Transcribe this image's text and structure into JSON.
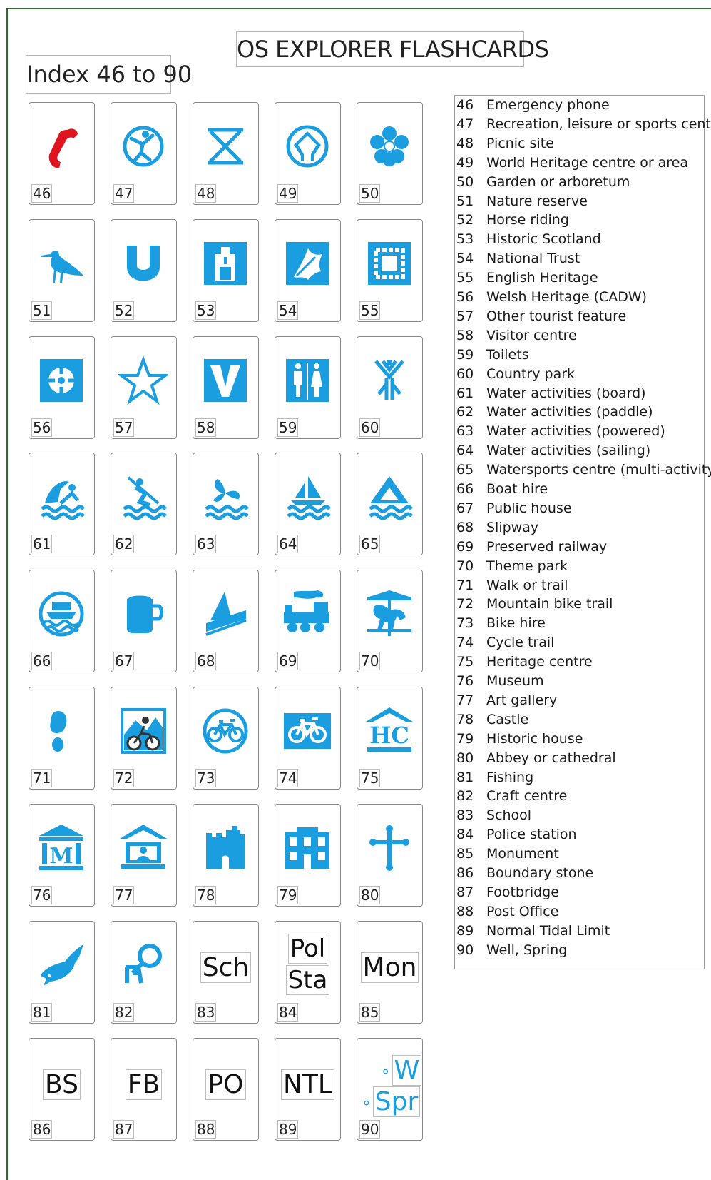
{
  "header": {
    "title": "OS EXPLORER FLASHCARDS",
    "subtitle": "Index 46 to 90"
  },
  "colors": {
    "icon": "#1a9ee0",
    "phone": "#e0141e",
    "frame": "#2f6f2f"
  },
  "cards": [
    {
      "num": "46",
      "icon": "phone-icon"
    },
    {
      "num": "47",
      "icon": "recreation-centre-icon"
    },
    {
      "num": "48",
      "icon": "picnic-site-icon"
    },
    {
      "num": "49",
      "icon": "world-heritage-icon"
    },
    {
      "num": "50",
      "icon": "garden-flower-icon"
    },
    {
      "num": "51",
      "icon": "nature-reserve-bird-icon"
    },
    {
      "num": "52",
      "icon": "horseshoe-icon"
    },
    {
      "num": "53",
      "icon": "historic-scotland-icon"
    },
    {
      "num": "54",
      "icon": "national-trust-icon"
    },
    {
      "num": "55",
      "icon": "english-heritage-icon"
    },
    {
      "num": "56",
      "icon": "cadw-icon"
    },
    {
      "num": "57",
      "icon": "star-icon"
    },
    {
      "num": "58",
      "icon": "visitor-centre-icon"
    },
    {
      "num": "59",
      "icon": "toilets-icon"
    },
    {
      "num": "60",
      "icon": "country-park-icon"
    },
    {
      "num": "61",
      "icon": "water-board-icon"
    },
    {
      "num": "62",
      "icon": "water-paddle-icon"
    },
    {
      "num": "63",
      "icon": "water-powered-icon"
    },
    {
      "num": "64",
      "icon": "water-sailing-icon"
    },
    {
      "num": "65",
      "icon": "watersports-centre-icon"
    },
    {
      "num": "66",
      "icon": "boat-hire-icon"
    },
    {
      "num": "67",
      "icon": "public-house-mug-icon"
    },
    {
      "num": "68",
      "icon": "slipway-icon"
    },
    {
      "num": "69",
      "icon": "steam-train-icon"
    },
    {
      "num": "70",
      "icon": "carousel-icon"
    },
    {
      "num": "71",
      "icon": "footprint-icon"
    },
    {
      "num": "72",
      "icon": "mountain-bike-icon"
    },
    {
      "num": "73",
      "icon": "bike-hire-icon"
    },
    {
      "num": "74",
      "icon": "cycle-trail-icon"
    },
    {
      "num": "75",
      "icon": "heritage-centre-icon",
      "label": "HC"
    },
    {
      "num": "76",
      "icon": "museum-icon",
      "label": "M"
    },
    {
      "num": "77",
      "icon": "art-gallery-icon"
    },
    {
      "num": "78",
      "icon": "castle-icon"
    },
    {
      "num": "79",
      "icon": "historic-house-icon"
    },
    {
      "num": "80",
      "icon": "cross-icon"
    },
    {
      "num": "81",
      "icon": "fish-icon"
    },
    {
      "num": "82",
      "icon": "craft-centre-icon"
    },
    {
      "num": "83",
      "text": [
        "Sch"
      ]
    },
    {
      "num": "84",
      "text": [
        "Pol",
        "Sta"
      ]
    },
    {
      "num": "85",
      "text": [
        "Mon"
      ]
    },
    {
      "num": "86",
      "text": [
        "BS"
      ]
    },
    {
      "num": "87",
      "text": [
        "FB"
      ]
    },
    {
      "num": "88",
      "text": [
        "PO"
      ]
    },
    {
      "num": "89",
      "text": [
        "NTL"
      ]
    },
    {
      "num": "90",
      "text": [
        "W",
        "Spr"
      ]
    }
  ],
  "legend": [
    {
      "n": "46",
      "label": "Emergency phone"
    },
    {
      "n": "47",
      "label": "Recreation, leisure or sports centre"
    },
    {
      "n": "48",
      "label": "Picnic site"
    },
    {
      "n": "49",
      "label": "World Heritage centre or area"
    },
    {
      "n": "50",
      "label": "Garden or arboretum"
    },
    {
      "n": "51",
      "label": "Nature reserve"
    },
    {
      "n": "52",
      "label": "Horse riding"
    },
    {
      "n": "53",
      "label": "Historic Scotland"
    },
    {
      "n": "54",
      "label": "National Trust"
    },
    {
      "n": "55",
      "label": "English Heritage"
    },
    {
      "n": "56",
      "label": "Welsh Heritage (CADW)"
    },
    {
      "n": "57",
      "label": "Other tourist feature"
    },
    {
      "n": "58",
      "label": "Visitor centre"
    },
    {
      "n": "59",
      "label": "Toilets"
    },
    {
      "n": "60",
      "label": "Country park"
    },
    {
      "n": "61",
      "label": "Water activities (board)"
    },
    {
      "n": "62",
      "label": "Water activities (paddle)"
    },
    {
      "n": "63",
      "label": "Water activities (powered)"
    },
    {
      "n": "64",
      "label": "Water activities (sailing)"
    },
    {
      "n": "65",
      "label": "Watersports centre (multi-activity)"
    },
    {
      "n": "66",
      "label": "Boat hire"
    },
    {
      "n": "67",
      "label": "Public house"
    },
    {
      "n": "68",
      "label": "Slipway"
    },
    {
      "n": "69",
      "label": "Preserved railway"
    },
    {
      "n": "70",
      "label": "Theme park"
    },
    {
      "n": "71",
      "label": "Walk or trail"
    },
    {
      "n": "72",
      "label": "Mountain bike trail"
    },
    {
      "n": "73",
      "label": "Bike hire"
    },
    {
      "n": "74",
      "label": "Cycle trail"
    },
    {
      "n": "75",
      "label": "Heritage centre"
    },
    {
      "n": "76",
      "label": "Museum"
    },
    {
      "n": "77",
      "label": "Art gallery"
    },
    {
      "n": "78",
      "label": "Castle"
    },
    {
      "n": "79",
      "label": "Historic house"
    },
    {
      "n": "80",
      "label": "Abbey or cathedral"
    },
    {
      "n": "81",
      "label": "Fishing"
    },
    {
      "n": "82",
      "label": "Craft centre"
    },
    {
      "n": "83",
      "label": "School"
    },
    {
      "n": "84",
      "label": "Police station"
    },
    {
      "n": "85",
      "label": "Monument"
    },
    {
      "n": "86",
      "label": "Boundary stone"
    },
    {
      "n": "87",
      "label": "Footbridge"
    },
    {
      "n": "88",
      "label": "Post Office"
    },
    {
      "n": "89",
      "label": "Normal Tidal Limit"
    },
    {
      "n": "90",
      "label": "Well, Spring"
    }
  ]
}
